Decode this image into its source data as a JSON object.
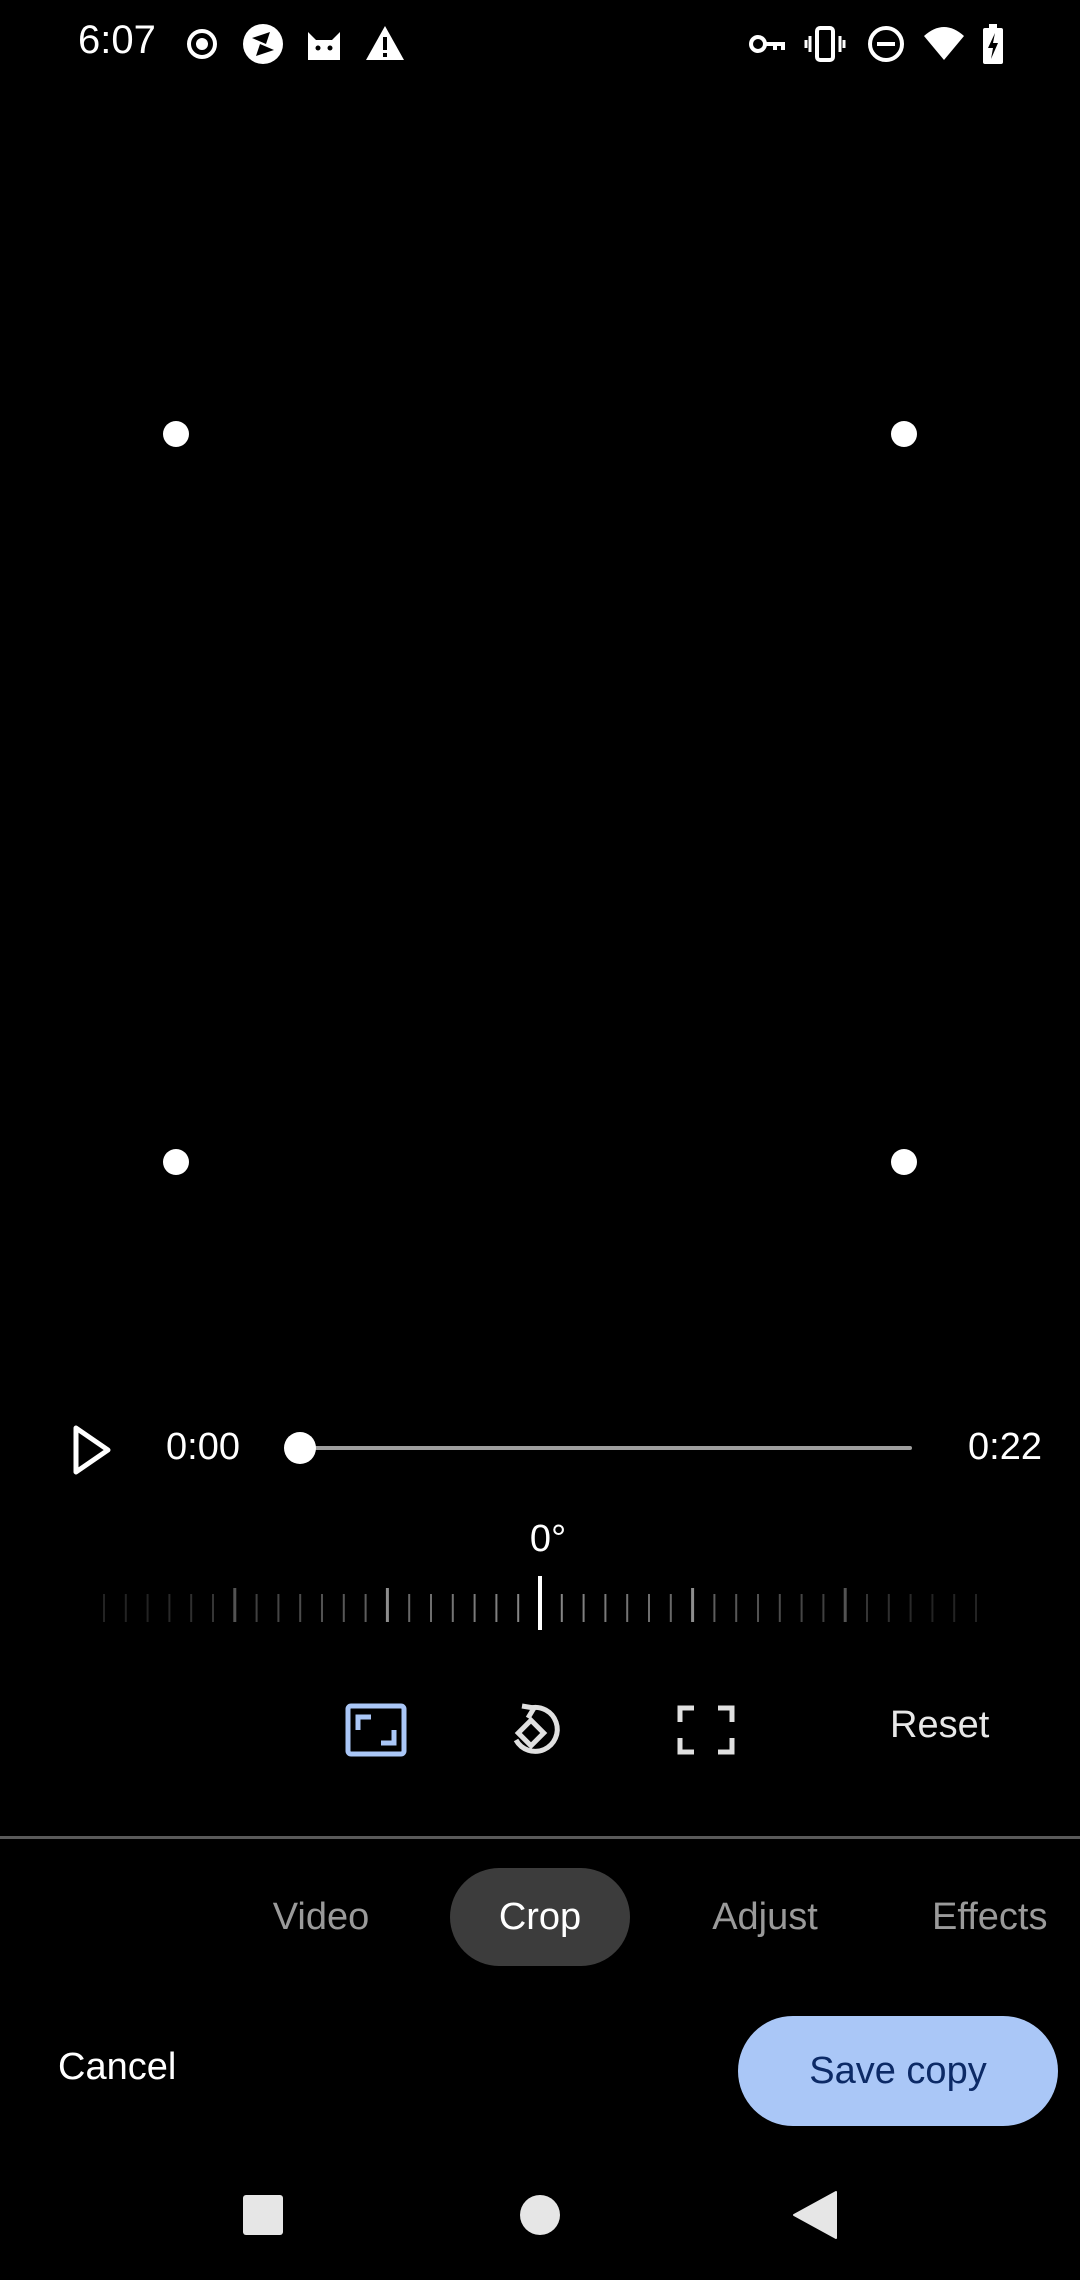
{
  "status_bar": {
    "time": "6:07",
    "left_icons": [
      "record-icon",
      "photo-app-icon",
      "cat-icon",
      "warning-icon"
    ],
    "right_icons": [
      "vpn-key-icon",
      "vibrate-icon",
      "do-not-disturb-icon",
      "wifi-icon",
      "battery-charging-icon"
    ]
  },
  "player": {
    "current_time": "0:00",
    "duration": "0:22",
    "progress": 0.0
  },
  "rotation": {
    "angle": "0°"
  },
  "crop_tools": {
    "aspect_icon": "aspect-ratio-icon",
    "rotate_icon": "rotate-icon",
    "free_crop_icon": "crop-free-icon",
    "reset_label": "Reset",
    "accent_color": "#aac7f7"
  },
  "tabs": [
    {
      "label": "Video",
      "active": false
    },
    {
      "label": "Crop",
      "active": true
    },
    {
      "label": "Adjust",
      "active": false
    },
    {
      "label": "Effects",
      "active": false
    }
  ],
  "actions": {
    "cancel_label": "Cancel",
    "save_label": "Save copy"
  },
  "nav_bar": {
    "icons": [
      "recents-icon",
      "home-icon",
      "back-icon"
    ]
  }
}
